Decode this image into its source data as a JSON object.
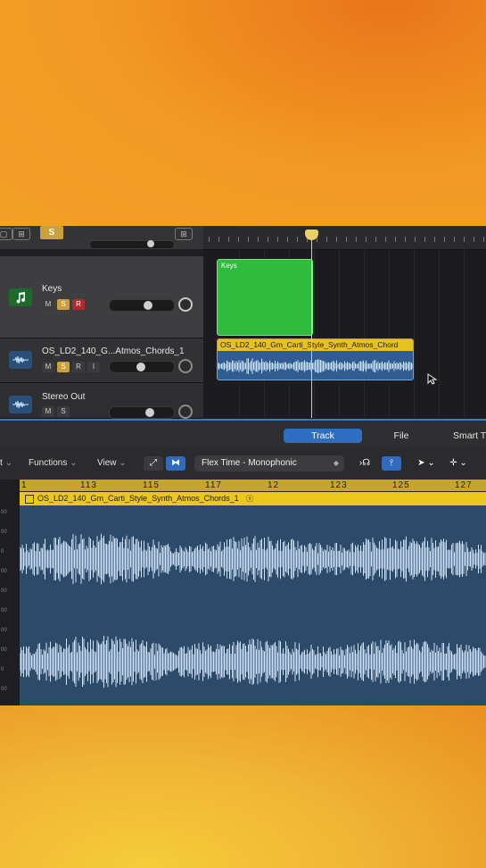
{
  "top_bar": {
    "solo_label": "S"
  },
  "tracks": [
    {
      "name": "Keys",
      "buttons": [
        "M",
        "S",
        "R"
      ]
    },
    {
      "name": "OS_LD2_140_G...Atmos_Chords_1",
      "buttons": [
        "M",
        "S",
        "R",
        "I"
      ]
    },
    {
      "name": "Stereo Out",
      "buttons": [
        "M",
        "S"
      ]
    }
  ],
  "regions": {
    "keys": "Keys",
    "audio": "OS_LD2_140_Gm_Carti_Style_Synth_Atmos_Chord"
  },
  "editor": {
    "tabs": [
      {
        "label": "Track",
        "active": true
      },
      {
        "label": "File",
        "active": false
      },
      {
        "label": "Smart T",
        "active": false
      }
    ],
    "toolbar": {
      "edit_fragment": "t",
      "functions_label": "Functions",
      "view_label": "View",
      "flex_mode": "Flex Time - Monophonic"
    },
    "bar_numbers": [
      "1",
      "113",
      "115",
      "117",
      "12",
      "123",
      "125",
      "127"
    ],
    "region_title": "OS_LD2_140_Gm_Carti_Style_Synth_Atmos_Chords_1",
    "scale_labels": [
      "00",
      "00",
      "0",
      "00",
      "00",
      "00",
      "00",
      "00",
      "0",
      "00",
      "00"
    ]
  },
  "colors": {
    "accent_blue": "#2d6dc2",
    "midi_region": "#2fbc3d",
    "audio_region_header": "#e6c21f",
    "solo": "#c9a03a",
    "record": "#b5282d",
    "playhead": "#e8d06a"
  }
}
